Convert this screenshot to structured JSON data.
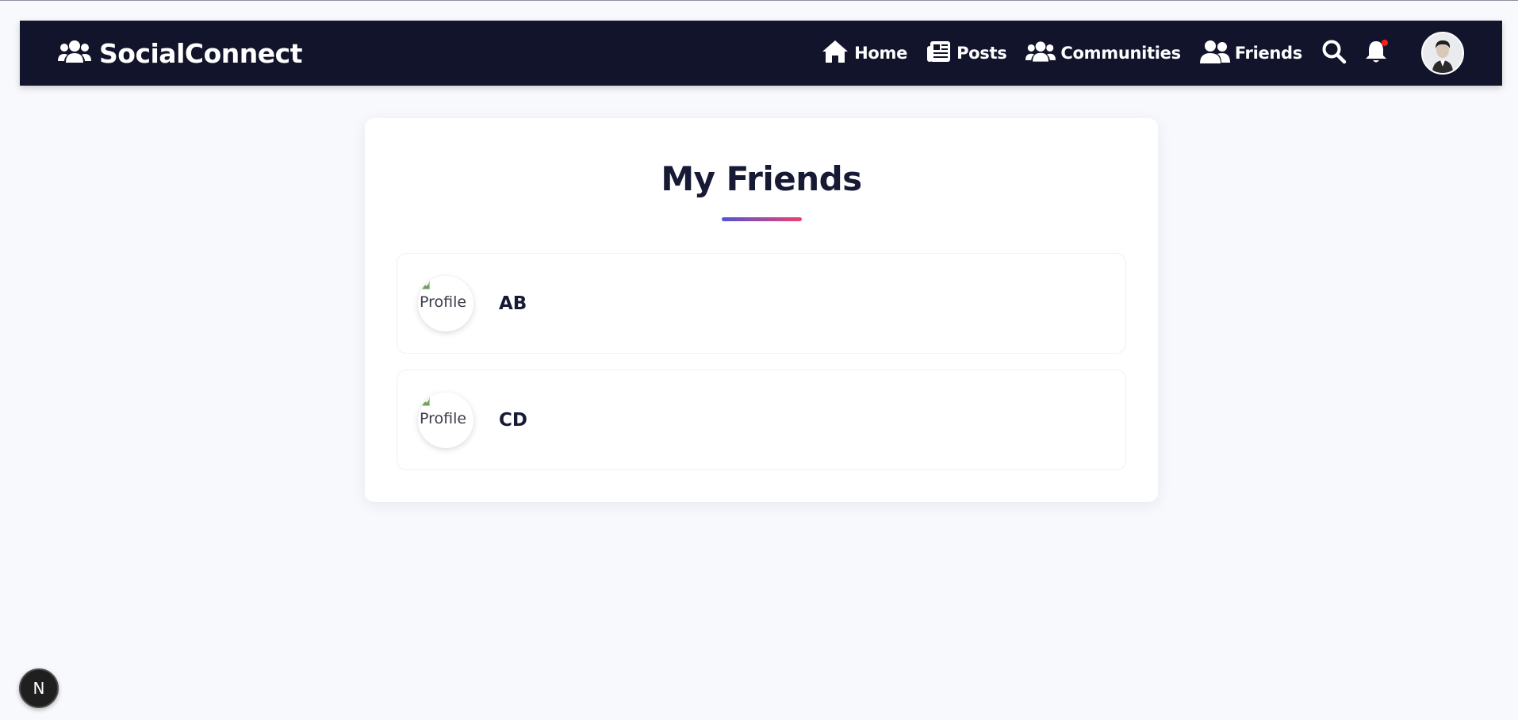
{
  "brand": {
    "name": "SocialConnect",
    "icon": "users-icon"
  },
  "nav": {
    "links": [
      {
        "label": "Home",
        "icon": "home-icon"
      },
      {
        "label": "Posts",
        "icon": "newspaper-icon"
      },
      {
        "label": "Communities",
        "icon": "users-icon"
      },
      {
        "label": "Friends",
        "icon": "user-friends-icon"
      }
    ],
    "search_icon": "search-icon",
    "notifications_icon": "bell-icon",
    "has_notification": true
  },
  "page": {
    "title": "My Friends",
    "accent_gradient": [
      "#4f56d8",
      "#f23e73"
    ]
  },
  "friends": [
    {
      "name": "AB",
      "image_alt": "Profile"
    },
    {
      "name": "CD",
      "image_alt": "Profile"
    }
  ],
  "dev_badge": {
    "label": "N"
  },
  "colors": {
    "navbar": "#11142b",
    "background": "#f8f9fd",
    "notification_dot": "#ff1a1a"
  }
}
